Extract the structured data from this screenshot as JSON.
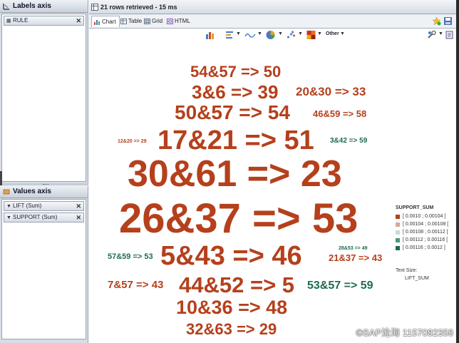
{
  "labels_axis": {
    "title": "Labels axis",
    "items": [
      {
        "label": "RULE"
      }
    ]
  },
  "values_axis": {
    "title": "Values axis",
    "items": [
      {
        "label": "LIFT (Sum)"
      },
      {
        "label": "SUPPORT (Sum)"
      }
    ]
  },
  "status": "21 rows retrieved - 15 ms",
  "tabs": [
    {
      "label": "Chart",
      "active": true
    },
    {
      "label": "Table",
      "active": false
    },
    {
      "label": "Grid",
      "active": false
    },
    {
      "label": "HTML",
      "active": false
    }
  ],
  "toolbar": {
    "other_label": "Other",
    "icons": [
      "bar-chart-icon",
      "align-icon",
      "line-chart-icon",
      "pie-chart-icon",
      "scatter-icon",
      "palette-icon"
    ]
  },
  "chart_data": {
    "type": "wordcloud",
    "words": [
      {
        "text": "54&57 => 50",
        "size": 22,
        "color": "#b5401c"
      },
      {
        "text": "3&6 => 39",
        "size": 26,
        "color": "#b5401c"
      },
      {
        "text": "20&30 => 33",
        "size": 17,
        "color": "#b5401c"
      },
      {
        "text": "50&57 => 54",
        "size": 28,
        "color": "#b5401c"
      },
      {
        "text": "46&59 => 58",
        "size": 13,
        "color": "#b5401c"
      },
      {
        "text": "12&20 => 29",
        "size": 7,
        "color": "#b5401c"
      },
      {
        "text": "17&21 => 51",
        "size": 38,
        "color": "#b5401c"
      },
      {
        "text": "3&42 => 59",
        "size": 10,
        "color": "#1e6b4c"
      },
      {
        "text": "30&61 => 23",
        "size": 52,
        "color": "#b5401c"
      },
      {
        "text": "26&37 => 53",
        "size": 58,
        "color": "#b5401c"
      },
      {
        "text": "5&43 => 46",
        "size": 38,
        "color": "#b5401c"
      },
      {
        "text": "57&59 => 53",
        "size": 11,
        "color": "#1e6b4c"
      },
      {
        "text": "28&53 => 49",
        "size": 7,
        "color": "#1e6b4c"
      },
      {
        "text": "21&37 => 43",
        "size": 13,
        "color": "#b5401c"
      },
      {
        "text": "7&57 => 43",
        "size": 15,
        "color": "#b5401c"
      },
      {
        "text": "44&52 => 5",
        "size": 31,
        "color": "#b5401c"
      },
      {
        "text": "53&57 => 59",
        "size": 16,
        "color": "#1e6b4c"
      },
      {
        "text": "10&36 => 48",
        "size": 27,
        "color": "#b5401c"
      },
      {
        "text": "32&63 => 29",
        "size": 22,
        "color": "#b5401c"
      }
    ],
    "legend": {
      "title": "SUPPORT_SUM",
      "items": [
        {
          "label": "[ 0.0010 ; 0.00104 [",
          "color": "#b5401c"
        },
        {
          "label": "[ 0.00104 ; 0.00108 [",
          "color": "#d6a898"
        },
        {
          "label": "[ 0.00108 ; 0.00112 [",
          "color": "#c9dccf"
        },
        {
          "label": "[ 0.00112 ; 0.00116 [",
          "color": "#4f9777"
        },
        {
          "label": "[ 0.00116 ; 0.0012 ]",
          "color": "#1e6b4c"
        }
      ],
      "text_size_label": "Text Size:",
      "text_size_value": "LIFT_SUM"
    }
  },
  "watermark": "©SAP沧海 1157082358"
}
